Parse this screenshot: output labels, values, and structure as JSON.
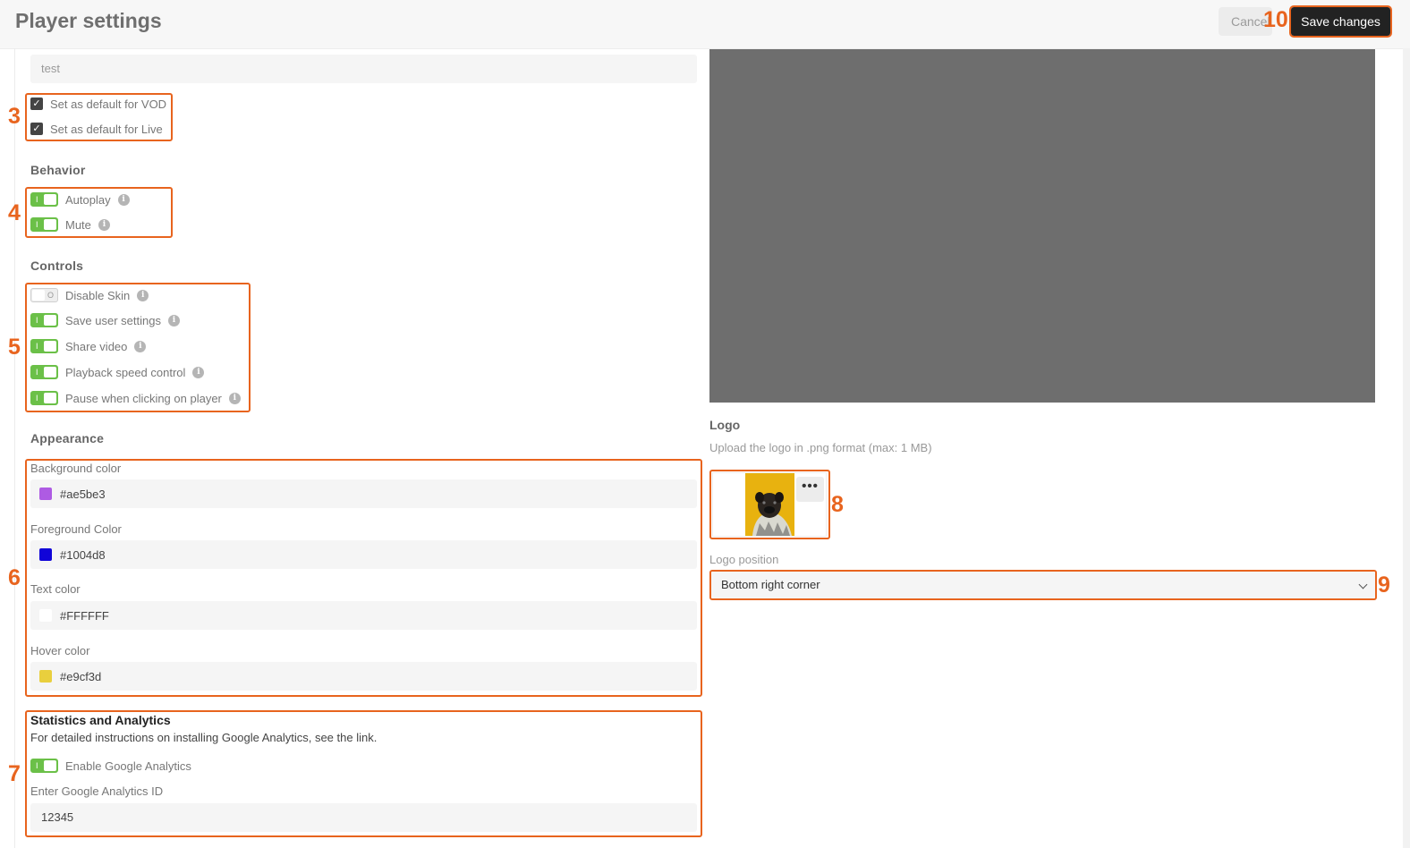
{
  "header": {
    "title": "Player settings",
    "cancel_label": "Cancel",
    "save_label": "Save changes"
  },
  "name_input": {
    "value": "test"
  },
  "defaults": [
    {
      "label": "Set as default for VOD",
      "checked": true
    },
    {
      "label": "Set as default for Live",
      "checked": true
    }
  ],
  "behavior": {
    "title": "Behavior",
    "items": [
      {
        "label": "Autoplay",
        "on": true
      },
      {
        "label": "Mute",
        "on": true
      }
    ]
  },
  "controls": {
    "title": "Controls",
    "items": [
      {
        "label": "Disable Skin",
        "on": false
      },
      {
        "label": "Save user settings",
        "on": true
      },
      {
        "label": "Share video",
        "on": true
      },
      {
        "label": "Playback speed control",
        "on": true
      },
      {
        "label": "Pause when clicking on player",
        "on": true
      }
    ]
  },
  "appearance": {
    "title": "Appearance",
    "colors": [
      {
        "label": "Background color",
        "value": "#ae5be3",
        "swatch": "#ae5be3"
      },
      {
        "label": "Foreground Color",
        "value": "#1004d8",
        "swatch": "#1004d8"
      },
      {
        "label": "Text color",
        "value": "#FFFFFF",
        "swatch": "#FFFFFF"
      },
      {
        "label": "Hover color",
        "value": "#e9cf3d",
        "swatch": "#e9cf3d"
      }
    ]
  },
  "analytics": {
    "title": "Statistics and Analytics",
    "description": "For detailed instructions on installing Google Analytics, see the link.",
    "toggle_label": "Enable Google Analytics",
    "toggle_on": true,
    "id_label": "Enter Google Analytics ID",
    "id_value": "12345"
  },
  "logo": {
    "title": "Logo",
    "description": "Upload the logo in .png format (max: 1 MB)",
    "more_label": "•••",
    "position_label": "Logo position",
    "position_value": "Bottom right corner"
  },
  "markers": {
    "m3": "3",
    "m4": "4",
    "m5": "5",
    "m6": "6",
    "m7": "7",
    "m8": "8",
    "m9": "9",
    "m10": "10"
  },
  "colors": {
    "accent": "#e8641e",
    "toggle_on": "#6bc048",
    "preview_bg": "#6e6e6e"
  },
  "icons": {
    "info": "info-icon",
    "check": "check-icon",
    "chevron": "chevron-down-icon",
    "more": "more-icon"
  }
}
